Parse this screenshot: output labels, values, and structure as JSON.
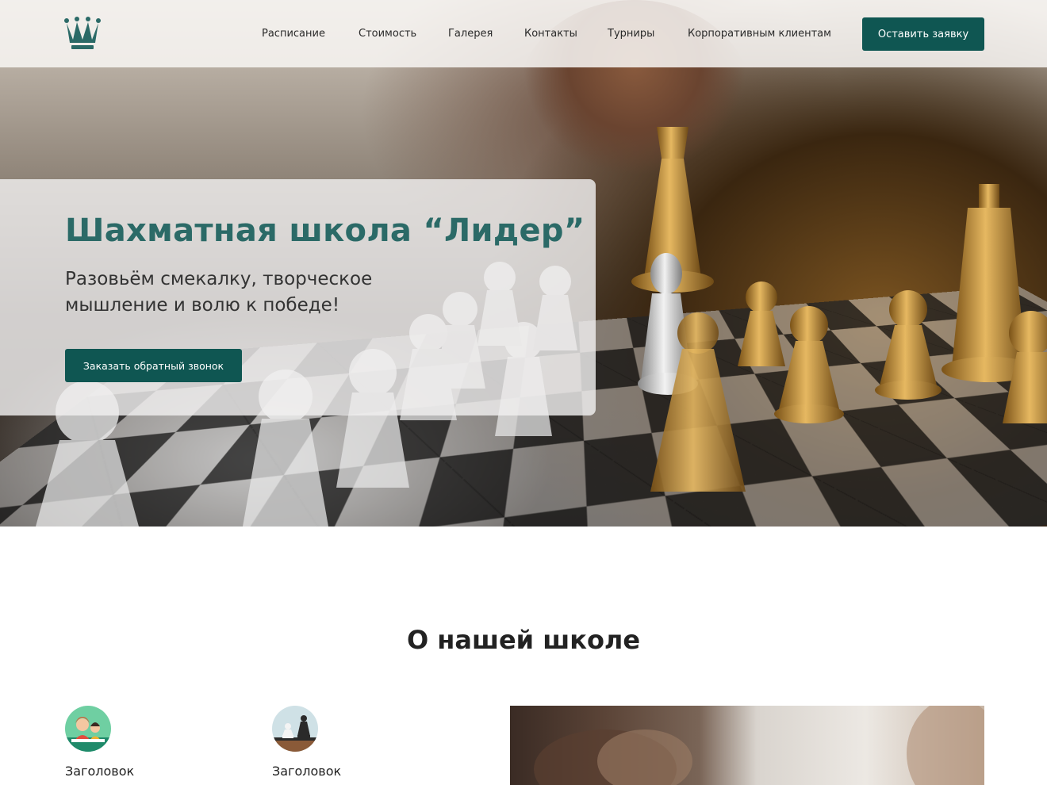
{
  "header": {
    "logo_icon": "crown-icon",
    "nav": [
      "Расписание",
      "Стоимость",
      "Галерея",
      "Контакты",
      "Турниры",
      "Корпоративным клиентам"
    ],
    "cta": "Оставить заявку"
  },
  "hero": {
    "title": "Шахматная школа “Лидер”",
    "subtitle": "Разовьём смекалку, творческое мышление и волю к победе!",
    "button": "Заказать обратный звонок"
  },
  "about": {
    "title": "О нашей школе",
    "features": [
      {
        "icon": "children-icon",
        "label": "Заголовок"
      },
      {
        "icon": "chess-pieces-icon",
        "label": "Заголовок"
      }
    ]
  },
  "colors": {
    "accent": "#0f5652",
    "title": "#2b6a67"
  }
}
